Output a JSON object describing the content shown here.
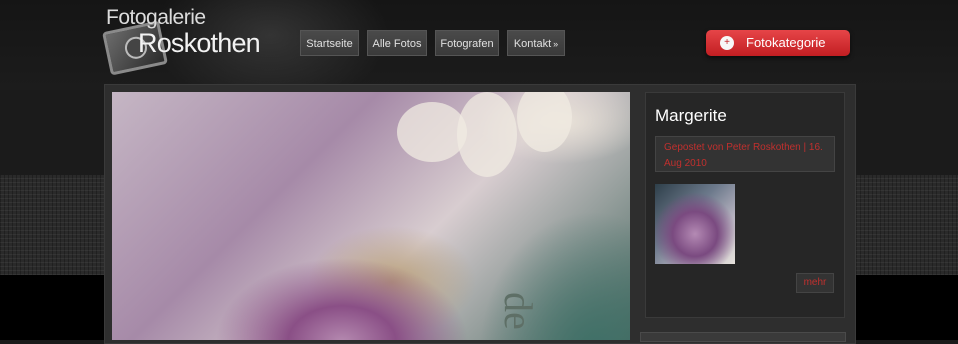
{
  "site": {
    "logo_line1": "Fotogalerie",
    "logo_line2": "Roskothen"
  },
  "nav": {
    "items": [
      {
        "label": "Startseite"
      },
      {
        "label": "Alle Fotos"
      },
      {
        "label": "Fotografen"
      },
      {
        "label": "Kontakt",
        "arrow": "»"
      }
    ]
  },
  "category_button": {
    "label": "Fotokategorie",
    "icon": "plus-icon",
    "color": "#d6282c"
  },
  "post": {
    "title": "Margerite",
    "meta": "Gepostet von Peter Roskothen | 16. Aug 2010",
    "more_label": "mehr",
    "photo_overlay_text": "de"
  },
  "colors": {
    "accent_red": "#c0302e",
    "background": "#1a1a1a"
  }
}
